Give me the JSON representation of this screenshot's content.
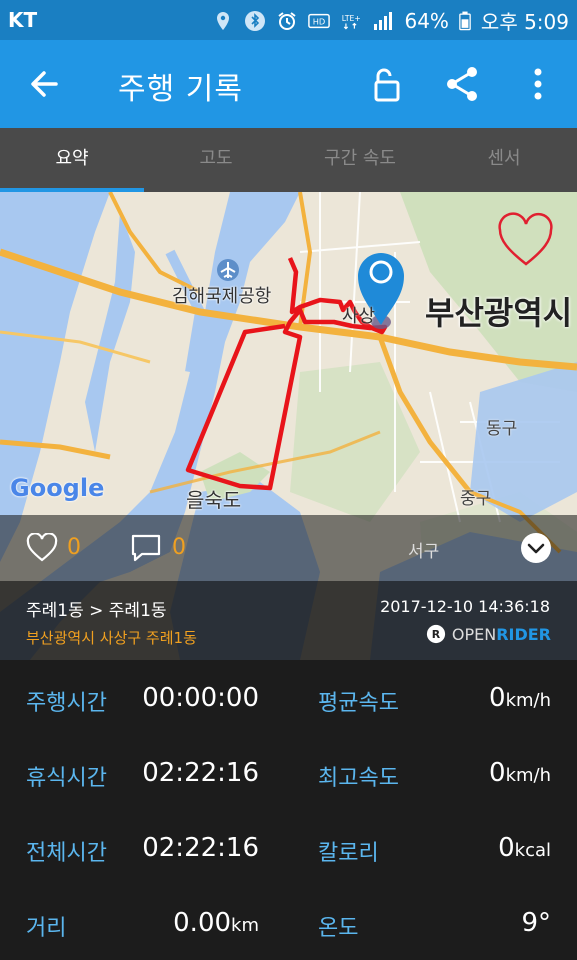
{
  "status_bar": {
    "carrier": "KT",
    "lte": "LTE",
    "battery": "64%",
    "time": "오후 5:09"
  },
  "app_bar": {
    "title": "주행 기록"
  },
  "tabs": [
    {
      "label": "요약"
    },
    {
      "label": "고도"
    },
    {
      "label": "구간 속도"
    },
    {
      "label": "센서"
    }
  ],
  "map": {
    "labels": {
      "airport": "김해국제공항",
      "busan": "부산광역시",
      "sasang": "사상",
      "eulsukdo": "을숙도",
      "donggu": "동구",
      "junggu": "중구",
      "seogu": "서구",
      "google": "Google"
    }
  },
  "social": {
    "likes": "0",
    "comments": "0"
  },
  "route": {
    "from_to": "주례1동 > 주례1동",
    "address": "부산광역시 사상구 주례1동",
    "datetime": "2017-12-10 14:36:18",
    "brand_open": "OPEN",
    "brand_rider": "RIDER"
  },
  "stats": {
    "riding_time": {
      "label": "주행시간",
      "value": "00:00:00"
    },
    "avg_speed": {
      "label": "평균속도",
      "value": "0",
      "unit": "km/h"
    },
    "rest_time": {
      "label": "휴식시간",
      "value": "02:22:16"
    },
    "max_speed": {
      "label": "최고속도",
      "value": "0",
      "unit": "km/h"
    },
    "total_time": {
      "label": "전체시간",
      "value": "02:22:16"
    },
    "calories": {
      "label": "칼로리",
      "value": "0",
      "unit": "kcal"
    },
    "distance": {
      "label": "거리",
      "value": "0.00",
      "unit": "km"
    },
    "temperature": {
      "label": "온도",
      "value": "9°"
    }
  },
  "colors": {
    "accent": "#2196e4",
    "status": "#1a7fc2",
    "label_blue": "#5bb6ee",
    "route_red": "#e8141a",
    "address_orange": "#f0a020"
  }
}
